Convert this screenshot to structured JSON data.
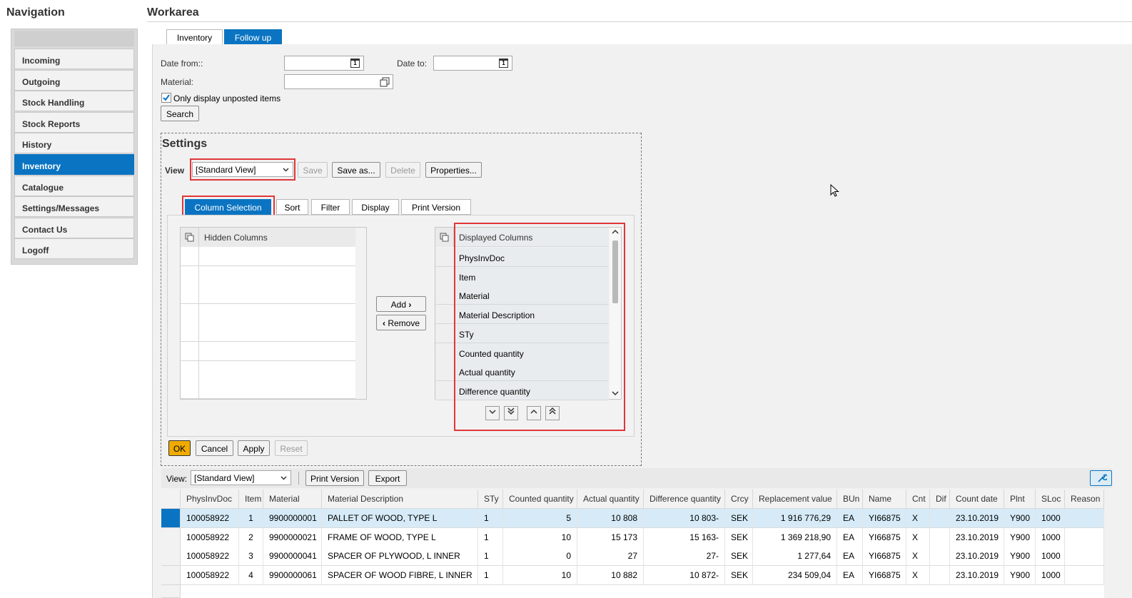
{
  "navigation": {
    "title": "Navigation",
    "items": [
      "Incoming",
      "Outgoing",
      "Stock Handling",
      "Stock Reports",
      "History",
      "Inventory",
      "Catalogue",
      "Settings/Messages",
      "Contact Us",
      "Logoff"
    ],
    "active": "Inventory"
  },
  "workarea": {
    "title": "Workarea",
    "tabs": [
      "Inventory",
      "Follow up"
    ],
    "active_tab": "Follow up"
  },
  "search": {
    "date_from_label": "Date from::",
    "date_to_label": "Date to:",
    "material_label": "Material:",
    "only_unposted_label": "Only display unposted items",
    "only_unposted_checked": true,
    "search_button": "Search",
    "calendar_day": "1"
  },
  "settings": {
    "title": "Settings",
    "view_label": "View",
    "view_value": "[Standard View]",
    "buttons": {
      "save": "Save",
      "save_as": "Save as...",
      "delete": "Delete",
      "properties": "Properties..."
    },
    "tabs": [
      "Column Selection",
      "Sort",
      "Filter",
      "Display",
      "Print Version"
    ],
    "hidden_columns_header": "Hidden Columns",
    "displayed_columns_header": "Displayed Columns",
    "displayed_columns": [
      "PhysInvDoc",
      "Item",
      "Material",
      "Material Description",
      "STy",
      "Counted quantity",
      "Actual quantity",
      "Difference quantity"
    ],
    "add_button": "Add",
    "remove_button": "Remove",
    "footer_buttons": {
      "ok": "OK",
      "cancel": "Cancel",
      "apply": "Apply",
      "reset": "Reset"
    }
  },
  "table": {
    "view_label": "View:",
    "view_value": "[Standard View]",
    "print_version": "Print Version",
    "export": "Export",
    "columns": [
      "PhysInvDoc",
      "Item",
      "Material",
      "Material Description",
      "STy",
      "Counted quantity",
      "Actual quantity",
      "Difference quantity",
      "Crcy",
      "Replacement value",
      "BUn",
      "Name",
      "Cnt",
      "Dif",
      "Count date",
      "Plnt",
      "SLoc",
      "Reason"
    ],
    "rows": [
      [
        "100058922",
        "1",
        "9900000001",
        "PALLET OF WOOD, TYPE L",
        "1",
        "5",
        "10 808",
        "10 803-",
        "SEK",
        "1 916 776,29",
        "EA",
        "YI66875",
        "X",
        "",
        "23.10.2019",
        "Y900",
        "1000",
        ""
      ],
      [
        "100058922",
        "2",
        "9900000021",
        "FRAME OF WOOD, TYPE L",
        "1",
        "10",
        "15 173",
        "15 163-",
        "SEK",
        "1 369 218,90",
        "EA",
        "YI66875",
        "X",
        "",
        "23.10.2019",
        "Y900",
        "1000",
        ""
      ],
      [
        "100058922",
        "3",
        "9900000041",
        "SPACER OF PLYWOOD, L INNER",
        "1",
        "0",
        "27",
        "27-",
        "SEK",
        "1 277,64",
        "EA",
        "YI66875",
        "X",
        "",
        "23.10.2019",
        "Y900",
        "1000",
        ""
      ],
      [
        "100058922",
        "4",
        "9900000061",
        "SPACER OF WOOD FIBRE, L INNER",
        "1",
        "10",
        "10 882",
        "10 872-",
        "SEK",
        "234 509,04",
        "EA",
        "YI66875",
        "X",
        "",
        "23.10.2019",
        "Y900",
        "1000",
        ""
      ]
    ]
  },
  "colors": {
    "accent": "#0a74c2",
    "highlight": "#e0373a",
    "ok_button": "#f0ab00",
    "selected_row": "#d6ebf7"
  }
}
